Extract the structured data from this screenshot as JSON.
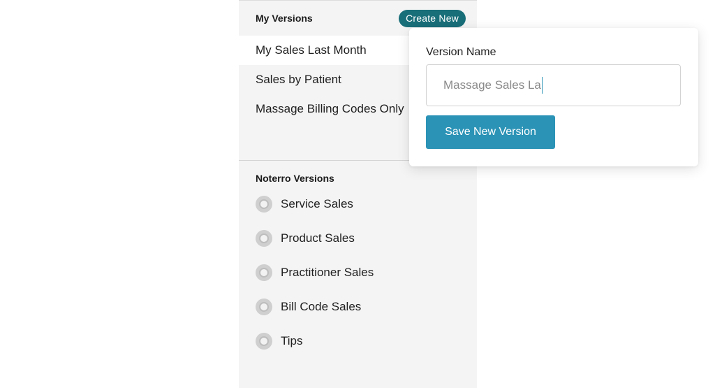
{
  "my_versions": {
    "title": "My Versions",
    "create_label": "Create New",
    "items": [
      {
        "label": "My Sales Last Month",
        "selected": true
      },
      {
        "label": "Sales by Patient",
        "selected": false
      },
      {
        "label": "Massage Billing Codes Only",
        "selected": false
      }
    ]
  },
  "noterro_versions": {
    "title": "Noterro Versions",
    "items": [
      {
        "label": "Service Sales",
        "icon": "report-icon"
      },
      {
        "label": "Product Sales",
        "icon": "report-icon"
      },
      {
        "label": "Practitioner Sales",
        "icon": "report-icon"
      },
      {
        "label": "Bill Code Sales",
        "icon": "report-icon"
      },
      {
        "label": "Tips",
        "icon": "report-icon"
      }
    ]
  },
  "new_version_form": {
    "field_label": "Version Name",
    "input_value": "Massage Sales La",
    "save_label": "Save New Version"
  },
  "colors": {
    "create_button": "#186e79",
    "save_button": "#2b93b6",
    "panel_background": "#f4f4f4"
  }
}
